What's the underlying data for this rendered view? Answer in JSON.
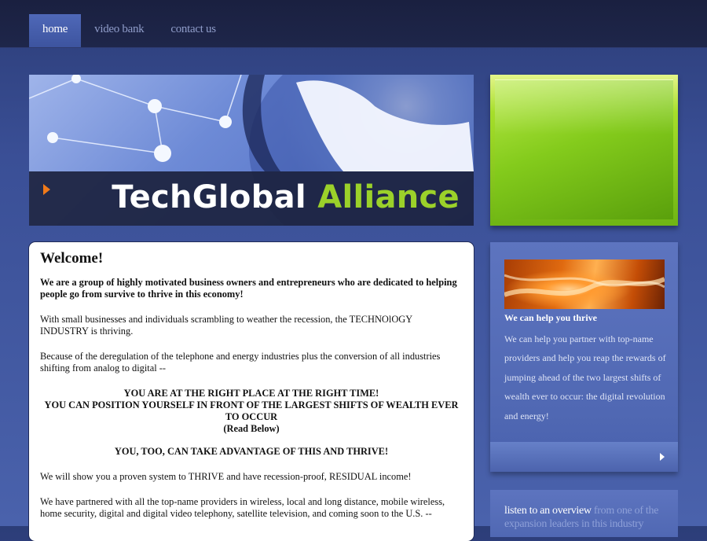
{
  "nav": {
    "items": [
      {
        "label": "home",
        "active": true
      },
      {
        "label": "video bank",
        "active": false
      },
      {
        "label": "contact us",
        "active": false
      }
    ]
  },
  "banner": {
    "brand_white": "TechGlobal",
    "brand_green": "Alliance",
    "colors": {
      "green": "#9bd12a",
      "arrow": "#f07a1a"
    }
  },
  "main": {
    "heading": "Welcome!",
    "lead": "We are a group of highly motivated business owners and entrepreneurs who are dedicated to helping people go from survive to thrive in this economy!",
    "p1": "With small businesses and individuals scrambling to weather the recession, the TECHNOlOGY INDUSTRY is thriving.",
    "p2": "Because of the deregulation of the telephone and energy industries plus the conversion of all industries shifting from analog to digital --",
    "center1": "YOU ARE AT THE RIGHT PLACE AT THE RIGHT TIME!",
    "center2": "YOU CAN POSITION YOURSELF IN FRONT OF THE LARGEST SHIFTS OF WEALTH EVER TO OCCUR",
    "center3": "(Read Below)",
    "center4": "YOU, TOO, CAN TAKE ADVANTAGE OF THIS AND THRIVE!",
    "p3": "We will show you a proven system to THRIVE and have recession-proof, RESIDUAL income!",
    "p4": "We have partnered with all the top-name providers in wireless, local and long distance, mobile wireless, home security, digital and digital video telephony, satellite television, and coming soon to the U.S. --"
  },
  "sidebar": {
    "title": "We can help you thrive",
    "text": "We can help you partner with top-name providers and help you reap the rewards of jumping ahead of the two largest shifts of wealth ever to occur: the digital revolution and energy!",
    "more_icon": "chevron-right-icon"
  },
  "sidebar2": {
    "text_white": "listen to an overview",
    "text_muted": " from one of the expansion leaders in this industry"
  }
}
